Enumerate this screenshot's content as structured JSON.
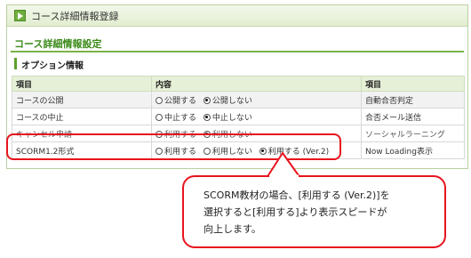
{
  "header": {
    "title": "コース詳細情報登録",
    "icon": "play-icon"
  },
  "section": {
    "title": "コース詳細情報設定"
  },
  "subsection": {
    "title": "オプション情報"
  },
  "table": {
    "headers": [
      "項目",
      "内容",
      "項目"
    ],
    "rows": [
      {
        "label": "コースの公開",
        "options": [
          {
            "label": "公開する",
            "checked": false
          },
          {
            "label": "公開しない",
            "checked": true
          }
        ],
        "right": "自動合否判定"
      },
      {
        "label": "コースの中止",
        "options": [
          {
            "label": "中止する",
            "checked": false
          },
          {
            "label": "中止しない",
            "checked": true
          }
        ],
        "right": "合否メール送信"
      },
      {
        "label": "キャンセル申請",
        "options": [
          {
            "label": "利用する",
            "checked": false
          },
          {
            "label": "利用しない",
            "checked": true
          }
        ],
        "right": "ソーシャルラーニング"
      },
      {
        "label": "SCORM1.2形式",
        "options": [
          {
            "label": "利用する",
            "checked": false
          },
          {
            "label": "利用しない",
            "checked": false
          },
          {
            "label": "利用する (Ver.2)",
            "checked": true
          }
        ],
        "right": "Now Loading表示"
      }
    ]
  },
  "callout": {
    "lines": [
      "SCORM教材の場合、[利用する (Ver.2)]を",
      "選択すると[利用する]より表示スピードが",
      "向上します。"
    ]
  },
  "colors": {
    "accent": "#5da02c",
    "highlight": "#e8141e"
  }
}
